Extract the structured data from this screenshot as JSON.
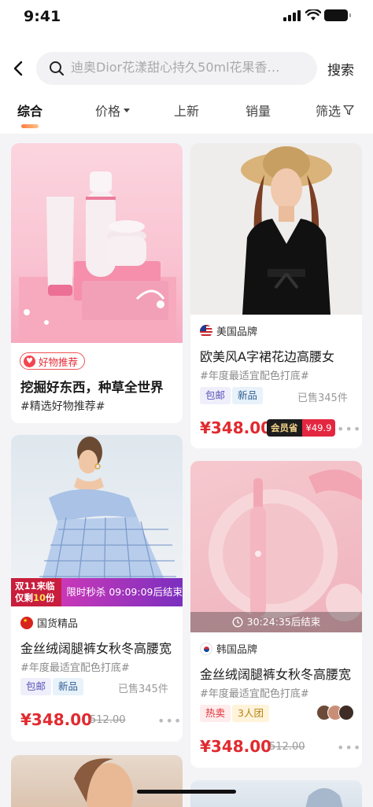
{
  "status_bar": {
    "time": "9:41"
  },
  "search": {
    "placeholder": "迪奥Dior花漾甜心持久50ml花果香…",
    "button": "搜索"
  },
  "tabs": [
    {
      "label": "综合",
      "active": true
    },
    {
      "label": "价格",
      "has_dropdown": true
    },
    {
      "label": "上新"
    },
    {
      "label": "销量"
    },
    {
      "label": "筛选",
      "has_filter_icon": true
    }
  ],
  "cards": [
    {
      "badge": "好物推荐",
      "title": "挖掘好东西，种草全世界",
      "subtitle": "#精选好物推荐#"
    },
    {
      "origin": "美国品牌",
      "title": "欧美风A字裙花边高腰女",
      "subtitle": "#年度最适宜配色打底#",
      "tags": [
        "包邮",
        "新品"
      ],
      "sold": "已售345件",
      "price": "¥348.00",
      "member_label": "会员省",
      "member_value": "¥49.9"
    },
    {
      "flash_left_1": "双11来临",
      "flash_left_2": "仅剩",
      "flash_left_num": "10",
      "flash_left_3": "份",
      "flash_right": "限时秒杀 09:09:09后结束",
      "origin": "国货精品",
      "title": "金丝绒阔腿裤女秋冬高腰宽",
      "subtitle": "#年度最适宜配色打底#",
      "tags": [
        "包邮",
        "新品"
      ],
      "sold": "已售345件",
      "price": "¥348.00",
      "original_price": "512.00"
    },
    {
      "countdown": "30:24:35后结束",
      "origin": "韩国品牌",
      "title": "金丝绒阔腿裤女秋冬高腰宽",
      "subtitle": "#年度最适宜配色打底#",
      "tags": [
        "热卖",
        "3人团"
      ],
      "price": "¥348.00",
      "original_price": "512.00"
    }
  ],
  "colors": {
    "accent": "#e12a2f",
    "tab_underline": "#ff7a3d"
  }
}
